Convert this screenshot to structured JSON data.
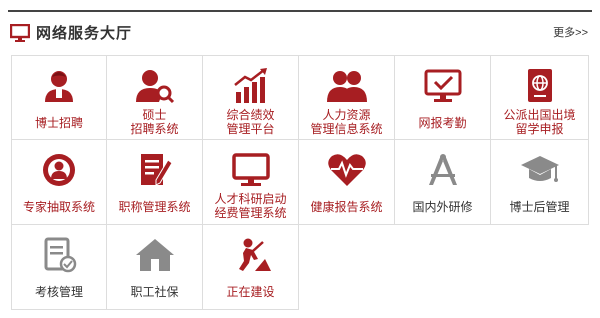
{
  "header": {
    "title": "网络服务大厅",
    "more": "更多>>"
  },
  "tiles": [
    {
      "label": "博士招聘",
      "icon": "doctor-person-icon",
      "color": "red"
    },
    {
      "label": "硕士\n招聘系统",
      "icon": "person-search-icon",
      "color": "red"
    },
    {
      "label": "综合绩效\n管理平台",
      "icon": "bar-chart-growth-icon",
      "color": "red"
    },
    {
      "label": "人力资源\n管理信息系统",
      "icon": "group-people-icon",
      "color": "red"
    },
    {
      "label": "网报考勤",
      "icon": "monitor-check-icon",
      "color": "red"
    },
    {
      "label": "公派出国出境\n留学申报",
      "icon": "passport-icon",
      "color": "red"
    },
    {
      "label": "专家抽取系统",
      "icon": "expert-person-icon",
      "color": "red"
    },
    {
      "label": "职称管理系统",
      "icon": "document-pen-icon",
      "color": "red"
    },
    {
      "label": "人才科研启动\n经费管理系统",
      "icon": "monitor-icon",
      "color": "red"
    },
    {
      "label": "健康报告系统",
      "icon": "heart-pulse-icon",
      "color": "red"
    },
    {
      "label": "国内外研修",
      "icon": "compass-drawing-icon",
      "color": "gray"
    },
    {
      "label": "博士后管理",
      "icon": "graduation-cap-icon",
      "color": "gray"
    },
    {
      "label": "考核管理",
      "icon": "checklist-doc-icon",
      "color": "gray"
    },
    {
      "label": "职工社保",
      "icon": "house-icon",
      "color": "gray"
    },
    {
      "label": "正在建设",
      "icon": "construction-worker-icon",
      "color": "red"
    }
  ],
  "colors": {
    "accent": "#a71e22",
    "gray_icon": "#8a8a8a",
    "border": "#dddddd"
  }
}
